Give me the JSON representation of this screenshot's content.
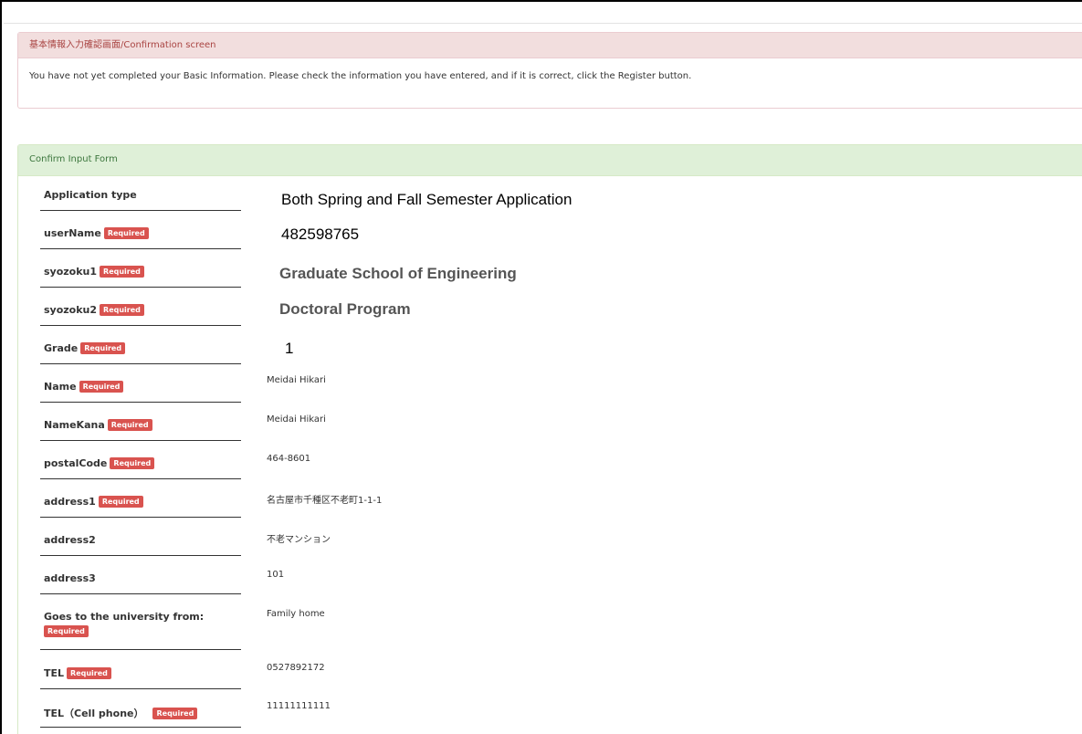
{
  "notice": {
    "title": "基本情報入力確認画面/Confirmation screen",
    "message": "You have not yet completed your Basic Information. Please check the information you have entered, and if it is correct, click the Register button."
  },
  "form": {
    "title": "Confirm Input Form",
    "required_label": "Required",
    "fields": [
      {
        "label": "Application type",
        "value": "Both Spring and Fall Semester Application"
      },
      {
        "label": "userName",
        "value": "482598765"
      },
      {
        "label": "syozoku1",
        "value": "Graduate School of Engineering"
      },
      {
        "label": "syozoku2",
        "value": "Doctoral Program"
      },
      {
        "label": "Grade",
        "value": "1"
      },
      {
        "label": "Name",
        "value": "Meidai Hikari"
      },
      {
        "label": "NameKana",
        "value": "Meidai Hikari"
      },
      {
        "label": "postalCode",
        "value": "464-8601"
      },
      {
        "label": "address1",
        "value": "名古屋市千種区不老町1-1-1"
      },
      {
        "label": "address2",
        "value": "不老マンション"
      },
      {
        "label": "address3",
        "value": "101"
      },
      {
        "label": "Goes to the university from:",
        "value": "Family home"
      },
      {
        "label": "TEL",
        "value": "0527892172"
      },
      {
        "label": "TEL（Cell phone）",
        "value": "11111111111"
      }
    ]
  }
}
